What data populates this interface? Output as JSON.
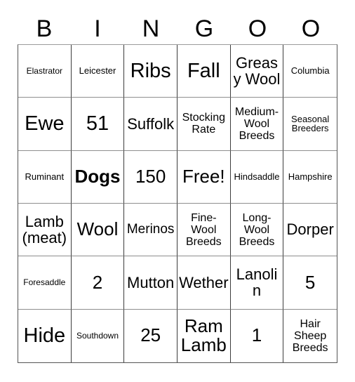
{
  "card": {
    "title": "BINGOO",
    "header_letters": [
      "B",
      "I",
      "N",
      "G",
      "O",
      "O"
    ],
    "columns": 6,
    "rows": 6,
    "colors": {
      "background": "#ffffff",
      "text": "#000000",
      "grid_line_vertical": "#3c3c3c",
      "grid_line_horizontal": "#8e8e8e",
      "border": "#555555"
    },
    "cells": [
      {
        "text": "Elastrator",
        "size": "fs-xs",
        "bold": false
      },
      {
        "text": "Leicester",
        "size": "fs-sm",
        "bold": false
      },
      {
        "text": "Ribs",
        "size": "fs-3xl",
        "bold": false
      },
      {
        "text": "Fall",
        "size": "fs-3xl",
        "bold": false
      },
      {
        "text": "Greasy Wool",
        "size": "fs-xl",
        "bold": false
      },
      {
        "text": "Columbia",
        "size": "fs-sm",
        "bold": false
      },
      {
        "text": "Ewe",
        "size": "fs-3xl",
        "bold": false
      },
      {
        "text": "51",
        "size": "fs-3xl",
        "bold": false
      },
      {
        "text": "Suffolk",
        "size": "fs-xl",
        "bold": false
      },
      {
        "text": "Stocking Rate",
        "size": "fs-md",
        "bold": false
      },
      {
        "text": "Medium-Wool Breeds",
        "size": "fs-md",
        "bold": false
      },
      {
        "text": "Seasonal Breeders",
        "size": "fs-sm",
        "bold": false
      },
      {
        "text": "Ruminant",
        "size": "fs-sm",
        "bold": false
      },
      {
        "text": "Dogs",
        "size": "fs-2xl",
        "bold": true
      },
      {
        "text": "150",
        "size": "fs-2xl",
        "bold": false
      },
      {
        "text": "Free!",
        "size": "fs-2xl",
        "bold": false
      },
      {
        "text": "Hindsaddle",
        "size": "fs-sm",
        "bold": false
      },
      {
        "text": "Hampshire",
        "size": "fs-sm",
        "bold": false
      },
      {
        "text": "Lamb (meat)",
        "size": "fs-xl",
        "bold": false
      },
      {
        "text": "Wool",
        "size": "fs-2xl",
        "bold": false
      },
      {
        "text": "Merinos",
        "size": "fs-lg",
        "bold": false
      },
      {
        "text": "Fine-Wool Breeds",
        "size": "fs-md",
        "bold": false
      },
      {
        "text": "Long-Wool Breeds",
        "size": "fs-md",
        "bold": false
      },
      {
        "text": "Dorper",
        "size": "fs-xl",
        "bold": false
      },
      {
        "text": "Foresaddle",
        "size": "fs-xs",
        "bold": false
      },
      {
        "text": "2",
        "size": "fs-2xl",
        "bold": false
      },
      {
        "text": "Mutton",
        "size": "fs-xl",
        "bold": false
      },
      {
        "text": "Wether",
        "size": "fs-xl",
        "bold": false
      },
      {
        "text": "Lanolin",
        "size": "fs-xl",
        "bold": false
      },
      {
        "text": "5",
        "size": "fs-2xl",
        "bold": false
      },
      {
        "text": "Hide",
        "size": "fs-3xl",
        "bold": false
      },
      {
        "text": "Southdown",
        "size": "fs-xs",
        "bold": false
      },
      {
        "text": "25",
        "size": "fs-2xl",
        "bold": false
      },
      {
        "text": "Ram Lamb",
        "size": "fs-2xl",
        "bold": false
      },
      {
        "text": "1",
        "size": "fs-2xl",
        "bold": false
      },
      {
        "text": "Hair Sheep Breeds",
        "size": "fs-md",
        "bold": false
      }
    ]
  }
}
